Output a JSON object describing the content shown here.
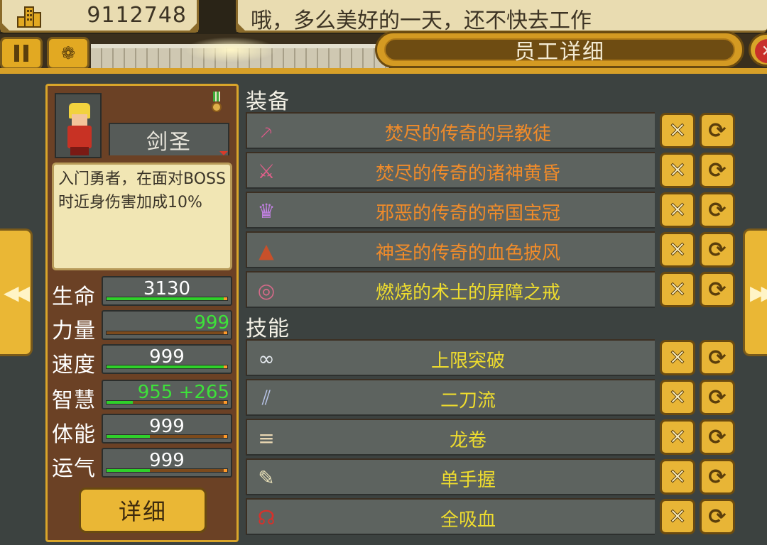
{
  "topbar": {
    "money_icon": "buildings-icon",
    "money": "9112748",
    "message": "哦，多么美好的一天，还不快去工作"
  },
  "toolbar": {
    "pause_icon": "pause-icon",
    "stats_icon": "stats-icon"
  },
  "panel": {
    "title": "员工详细",
    "close_icon": "close-icon"
  },
  "character": {
    "class_name": "剑圣",
    "description": "入门勇者，在面对BOSS时近身伤害加成10%",
    "stats": [
      {
        "label": "生命",
        "value": "3130",
        "fill": 1.0,
        "highlight": false
      },
      {
        "label": "力量",
        "value": "999",
        "fill": 0.0,
        "highlight": true
      },
      {
        "label": "速度",
        "value": "999",
        "fill": 0.97,
        "highlight": false
      },
      {
        "label": "智慧",
        "value": "955 +265",
        "fill": 0.22,
        "highlight": true
      },
      {
        "label": "体能",
        "value": "999",
        "fill": 0.36,
        "highlight": false
      },
      {
        "label": "运气",
        "value": "999",
        "fill": 0.36,
        "highlight": false
      }
    ],
    "detail_button": "详细"
  },
  "equipment": {
    "title": "装备",
    "items": [
      {
        "name": "焚尽的传奇的异教徒",
        "icon": "sword-icon",
        "color": "orange"
      },
      {
        "name": "焚尽的传奇的诸神黄昏",
        "icon": "greatsword-icon",
        "color": "orange"
      },
      {
        "name": "邪恶的传奇的帝国宝冠",
        "icon": "crown-icon",
        "color": "orange"
      },
      {
        "name": "神圣的传奇的血色披风",
        "icon": "cloak-icon",
        "color": "orange"
      },
      {
        "name": "燃烧的术士的屏障之戒",
        "icon": "ring-icon",
        "color": "yellow"
      }
    ]
  },
  "skills": {
    "title": "技能",
    "items": [
      {
        "name": "上限突破",
        "icon": "chain-icon",
        "color": "yellow"
      },
      {
        "name": "二刀流",
        "icon": "dual-blades-icon",
        "color": "yellow"
      },
      {
        "name": "龙卷",
        "icon": "tornado-icon",
        "color": "yellow"
      },
      {
        "name": "单手握",
        "icon": "one-hand-sword-icon",
        "color": "yellow"
      },
      {
        "name": "全吸血",
        "icon": "vampire-icon",
        "color": "yellow"
      }
    ]
  },
  "row_actions": {
    "remove_icon": "remove-icon",
    "swap_icon": "swap-icon"
  },
  "nav": {
    "prev_icon": "double-left-arrow-icon",
    "next_icon": "double-right-arrow-icon"
  }
}
